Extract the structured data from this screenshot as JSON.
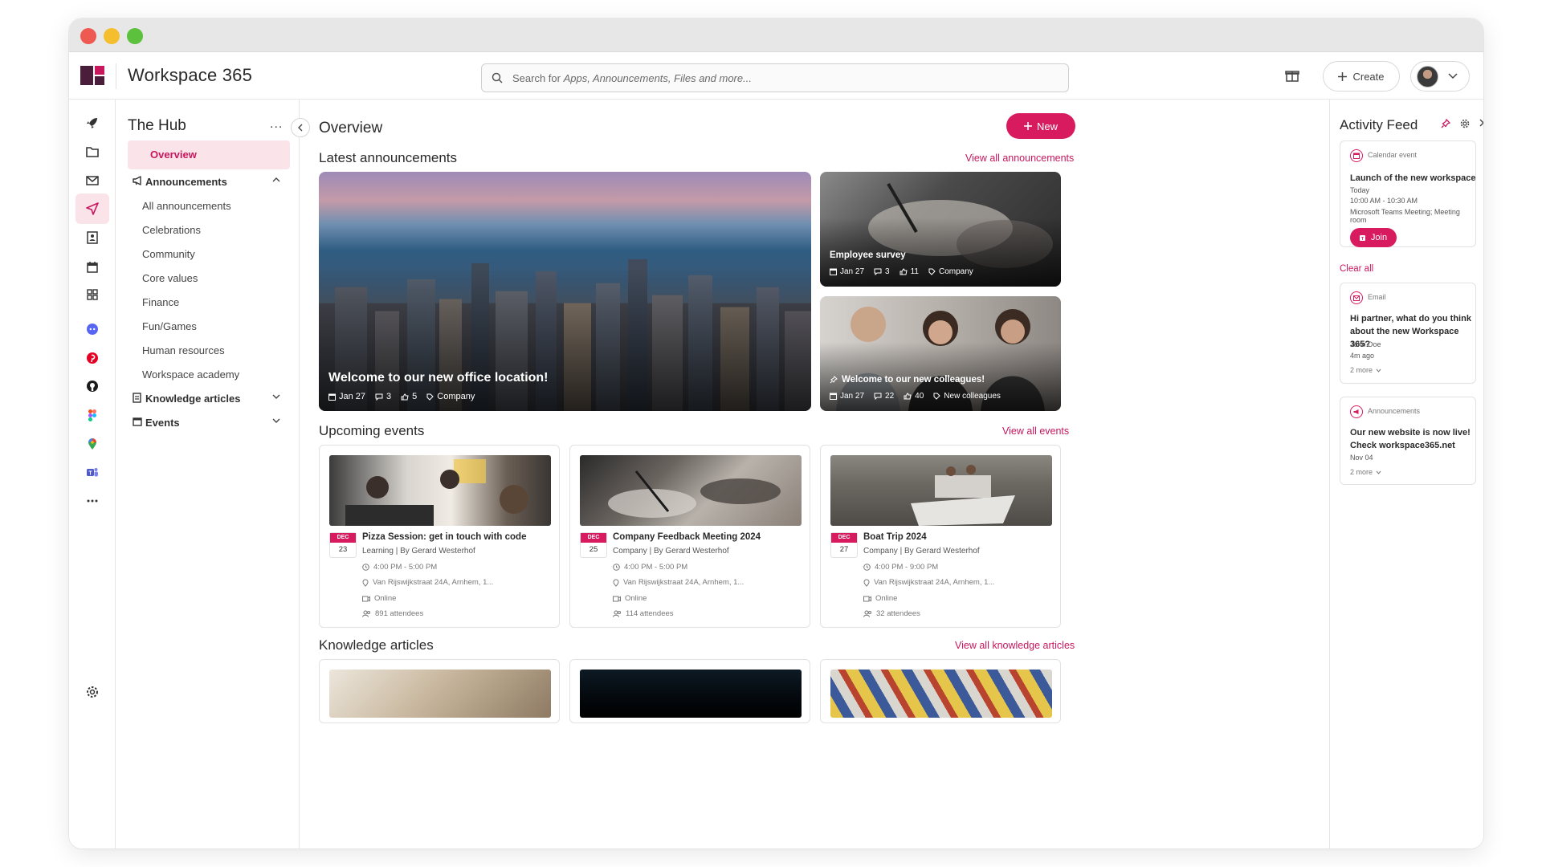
{
  "app": {
    "title": "Workspace 365"
  },
  "search": {
    "placeholder_prefix": "Search for ",
    "placeholder_rest": "Apps, Announcements, Files and more..."
  },
  "topbar": {
    "create_label": "Create"
  },
  "sidebar_icons": [
    "rocket-icon",
    "folder-icon",
    "mail-icon",
    "send-icon",
    "contacts-icon",
    "calendar-icon",
    "apps-grid-icon",
    "discord-icon",
    "pinterest-icon",
    "github-icon",
    "figma-icon",
    "maps-icon",
    "teams-icon",
    "more-icon",
    "settings-icon"
  ],
  "hub": {
    "title": "The Hub",
    "more": "...",
    "overview": "Overview",
    "announcements": "Announcements",
    "announcement_items": [
      "All announcements",
      "Celebrations",
      "Community",
      "Core values",
      "Finance",
      "Fun/Games",
      "Human resources",
      "Workspace academy"
    ],
    "knowledge": "Knowledge articles",
    "events": "Events"
  },
  "main": {
    "title": "Overview",
    "new_label": "New",
    "latest_title": "Latest announcements",
    "view_all_announcements": "View all announcements",
    "announcements": [
      {
        "title": "Welcome to our new office location!",
        "date": "Jan 27",
        "comments": "3",
        "likes": "5",
        "tag": "Company"
      },
      {
        "title": "Employee survey",
        "date": "Jan 27",
        "comments": "3",
        "likes": "11",
        "tag": "Company"
      },
      {
        "title": "Welcome to our new colleagues!",
        "date": "Jan 27",
        "comments": "22",
        "likes": "40",
        "tag": "New colleagues"
      }
    ],
    "events_title": "Upcoming events",
    "view_all_events": "View all events",
    "events": [
      {
        "month": "DEC",
        "day": "23",
        "title": "Pizza Session: get in touch with code",
        "sub": "Learning | By Gerard Westerhof",
        "time": "4:00 PM - 5:00 PM",
        "location": "Van Rijswijkstraat 24A, Arnhem, 1...",
        "mode": "Online",
        "attendees": "891 attendees"
      },
      {
        "month": "DEC",
        "day": "25",
        "title": "Company Feedback Meeting 2024",
        "sub": "Company | By Gerard Westerhof",
        "time": "4:00 PM - 5:00 PM",
        "location": "Van Rijswijkstraat 24A, Arnhem, 1...",
        "mode": "Online",
        "attendees": "114 attendees"
      },
      {
        "month": "DEC",
        "day": "27",
        "title": "Boat Trip 2024",
        "sub": "Company | By Gerard Westerhof",
        "time": "4:00 PM - 9:00 PM",
        "location": "Van Rijswijkstraat 24A, Arnhem, 1...",
        "mode": "Online",
        "attendees": "32 attendees"
      }
    ],
    "knowledge_title": "Knowledge articles",
    "view_all_knowledge": "View all knowledge articles"
  },
  "feed": {
    "title": "Activity Feed",
    "clear_all": "Clear all",
    "calendar": {
      "type": "Calendar event",
      "title": "Launch of the new workspace",
      "when": "Today",
      "time": "10:00 AM - 10:30 AM",
      "location": "Microsoft Teams Meeting; Meeting room",
      "join": "Join"
    },
    "email": {
      "type": "Email",
      "title": "Hi partner, what do you think about the new Workspace 365?",
      "from": "John Doe",
      "ago": "4m ago",
      "more": "2 more"
    },
    "announcement": {
      "type": "Announcements",
      "title": "Our new website is now live! Check workspace365.net",
      "date": "Nov 04",
      "more": "2 more"
    }
  },
  "colors": {
    "accent": "#d81b5e",
    "accent_light": "#fbe3ea",
    "brand_dark": "#4a1e3a"
  }
}
